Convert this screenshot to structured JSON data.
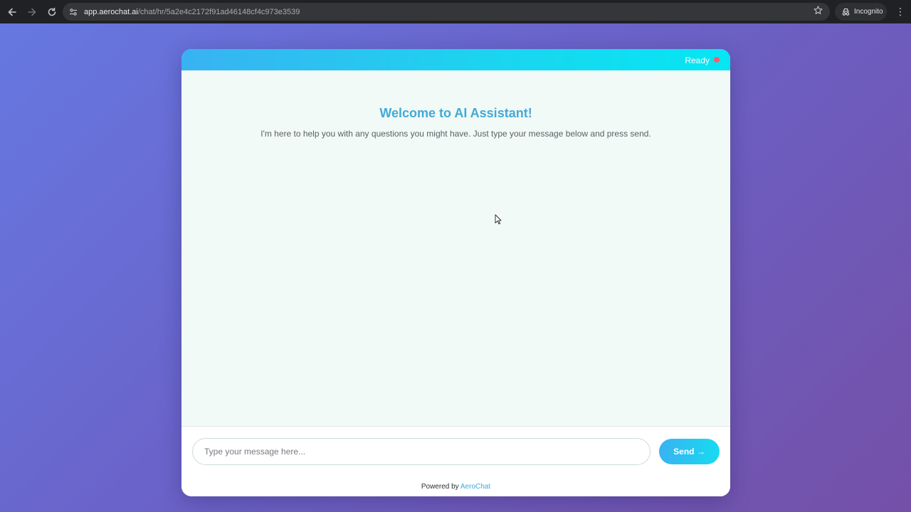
{
  "browser": {
    "url_host": "app.aerochat.ai",
    "url_path": "/chat/hr/5a2e4c2172f91ad46148cf4c973e3539",
    "incognito_label": "Incognito"
  },
  "chat": {
    "status_text": "Ready",
    "status_color": "#ff5a6a",
    "welcome_title": "Welcome to AI Assistant!",
    "welcome_text": "I'm here to help you with any questions you might have. Just type your message below and press send.",
    "input_placeholder": "Type your message here...",
    "input_value": "",
    "send_label": "Send →",
    "powered_prefix": "Powered by",
    "powered_brand": "AeroChat"
  },
  "colors": {
    "accent": "#43a9d8",
    "header_gradient_start": "#39b2f2",
    "header_gradient_end": "#05e6f3"
  }
}
